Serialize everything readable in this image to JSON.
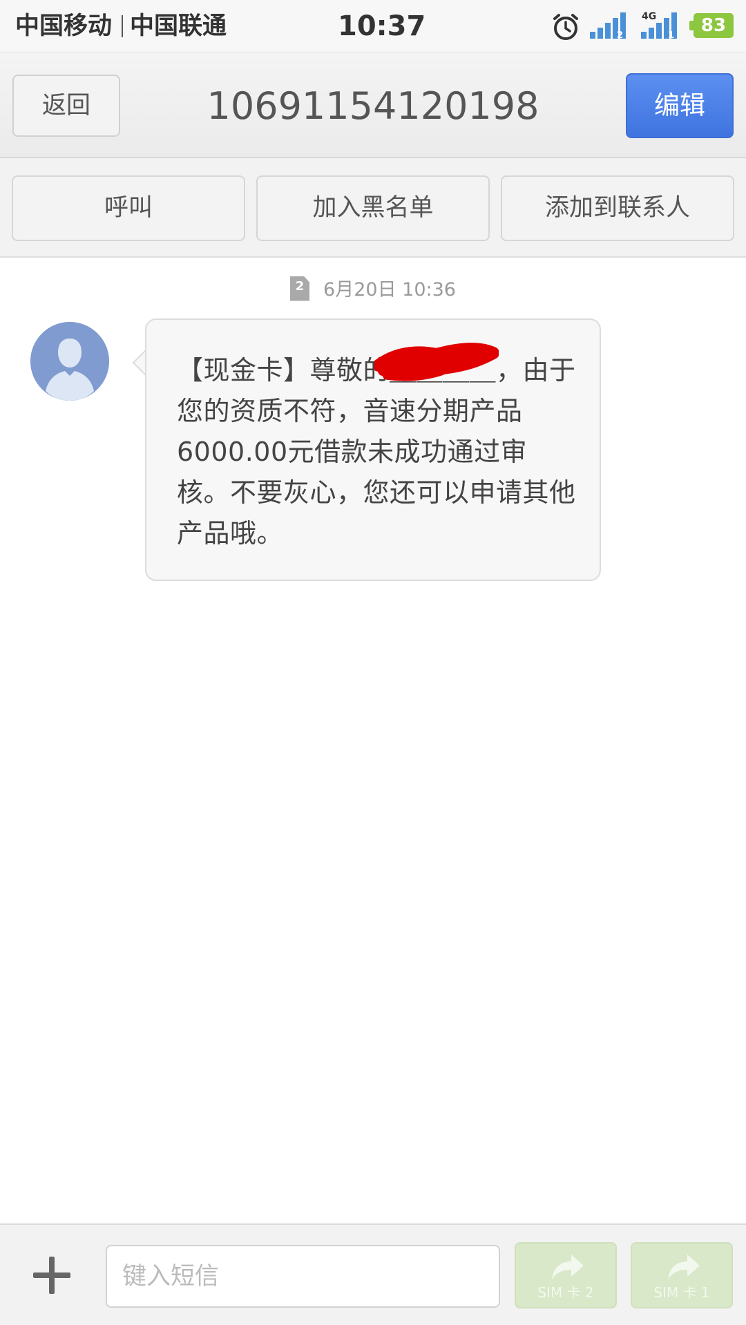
{
  "status_bar": {
    "carrier_1": "中国移动",
    "carrier_2": "中国联通",
    "time": "10:37",
    "network_label": "4G",
    "sim1_signal_badge": "2",
    "sim2_signal_badge": "1",
    "battery": "83",
    "icons": [
      "alarm-clock-icon",
      "signal-strength-icon",
      "signal-strength-icon",
      "battery-icon"
    ]
  },
  "header": {
    "back_label": "返回",
    "title": "10691154120198",
    "edit_label": "编辑"
  },
  "actions": {
    "call_label": "呼叫",
    "block_label": "加入黑名单",
    "add_contact_label": "添加到联系人"
  },
  "thread": {
    "sim_badge": "2",
    "timestamp": "6月20日 10:36",
    "messages": [
      {
        "text": "【现金卡】尊敬的＿＿＿＿，由于您的资质不符，音速分期产品6000.00元借款未成功通过审核。不要灰心，您还可以申请其他产品哦。"
      }
    ]
  },
  "composer": {
    "placeholder": "键入短信",
    "value": "",
    "send_sim2_label": "SIM 卡 2",
    "send_sim1_label": "SIM 卡 1"
  },
  "colors": {
    "accent_blue": "#4a7fe6",
    "battery_green": "#8dc63f",
    "send_disabled_green": "#d8e8c8",
    "redaction_red": "#e00000"
  }
}
